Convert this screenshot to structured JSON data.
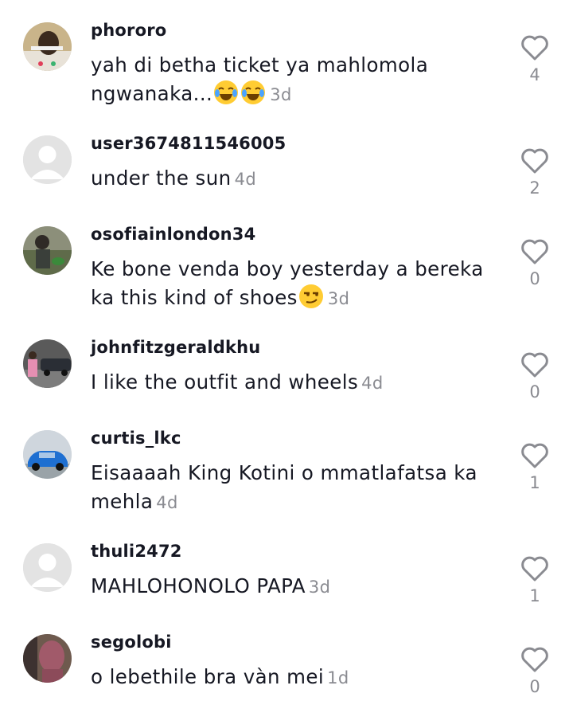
{
  "comments": [
    {
      "username": "phororo",
      "text": "yah di betha ticket ya mahlomola ngwanaka...",
      "emoji": [
        "face-with-tears-of-joy",
        "face-with-tears-of-joy"
      ],
      "time": "3d",
      "likes": "4",
      "avatar": "photo"
    },
    {
      "username": "user3674811546005",
      "text": "under the sun",
      "emoji": [],
      "time": "4d",
      "likes": "2",
      "avatar": "default"
    },
    {
      "username": "osofiainlondon34",
      "text": "Ke bone venda boy yesterday a bereka ka this kind of shoes",
      "emoji": [
        "smirking-face"
      ],
      "time": "3d",
      "likes": "0",
      "avatar": "photo"
    },
    {
      "username": "johnfitzgeraldkhu",
      "text": "I like the outfit and wheels",
      "emoji": [],
      "time": "4d",
      "likes": "0",
      "avatar": "photo"
    },
    {
      "username": "curtis_lkc",
      "text": "Eisaaaah King Kotini o mmatlafatsa ka mehla",
      "emoji": [],
      "time": "4d",
      "likes": "1",
      "avatar": "photo"
    },
    {
      "username": "thuli2472",
      "text": "MAHLOHONOLO PAPA",
      "emoji": [],
      "time": "3d",
      "likes": "1",
      "avatar": "default"
    },
    {
      "username": "segolobi",
      "text": "o lebethile bra vàn mei",
      "emoji": [],
      "time": "1d",
      "likes": "0",
      "avatar": "photo"
    }
  ],
  "colors": {
    "text": "#161823",
    "muted": "#8a8b91",
    "icon": "#8a8b91"
  }
}
